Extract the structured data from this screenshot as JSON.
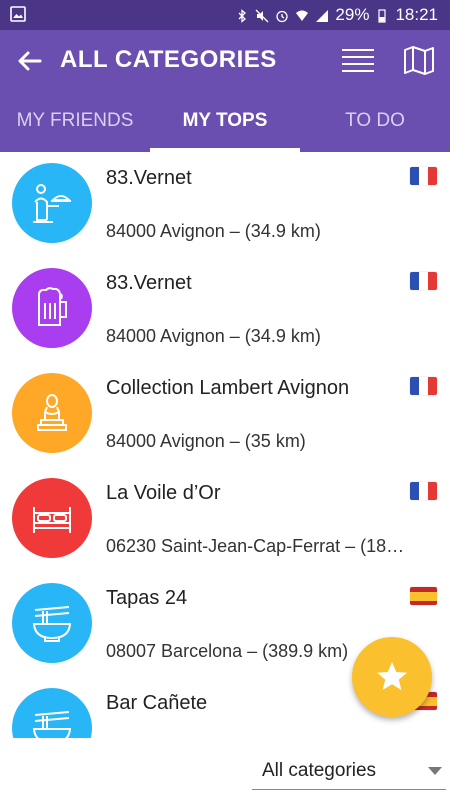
{
  "status_bar": {
    "battery": "29%",
    "time": "18:21"
  },
  "app_bar": {
    "title": "ALL CATEGORIES",
    "back_icon": "arrow-back-icon",
    "menu_icon": "list-menu-icon",
    "map_icon": "map-icon"
  },
  "tabs": [
    {
      "label": "MY FRIENDS",
      "active": false
    },
    {
      "label": "MY TOPS",
      "active": true
    },
    {
      "label": "TO DO",
      "active": false
    }
  ],
  "items": [
    {
      "title": "83.Vernet",
      "subtitle": "84000 Avignon – (34.9 km)",
      "icon": "waiter-icon",
      "color": "#29b6f6",
      "flag": "france"
    },
    {
      "title": "83.Vernet",
      "subtitle": "84000 Avignon – (34.9 km)",
      "icon": "beer-mug-icon",
      "color": "#a83ef0",
      "flag": "france"
    },
    {
      "title": "Collection Lambert Avignon",
      "subtitle": "84000 Avignon – (35 km)",
      "icon": "bust-statue-icon",
      "color": "#ffa726",
      "flag": "france"
    },
    {
      "title": "La Voile d’Or",
      "subtitle": "06230 Saint-Jean-Cap-Ferrat – (18…",
      "icon": "bed-icon",
      "color": "#f03a3a",
      "flag": "france"
    },
    {
      "title": "Tapas 24",
      "subtitle": "08007 Barcelona – (389.9 km)",
      "icon": "noodle-bowl-icon",
      "color": "#29b6f6",
      "flag": "spain"
    },
    {
      "title": "Bar Cañete",
      "subtitle": "",
      "icon": "noodle-bowl-icon",
      "color": "#29b6f6",
      "flag": "spain"
    }
  ],
  "fab": {
    "icon": "star-icon",
    "color": "#fbc02d"
  },
  "footer": {
    "category_select": "All categories"
  },
  "colors": {
    "app_bar": "#6a4fb0",
    "status_bar": "#4a3586"
  }
}
